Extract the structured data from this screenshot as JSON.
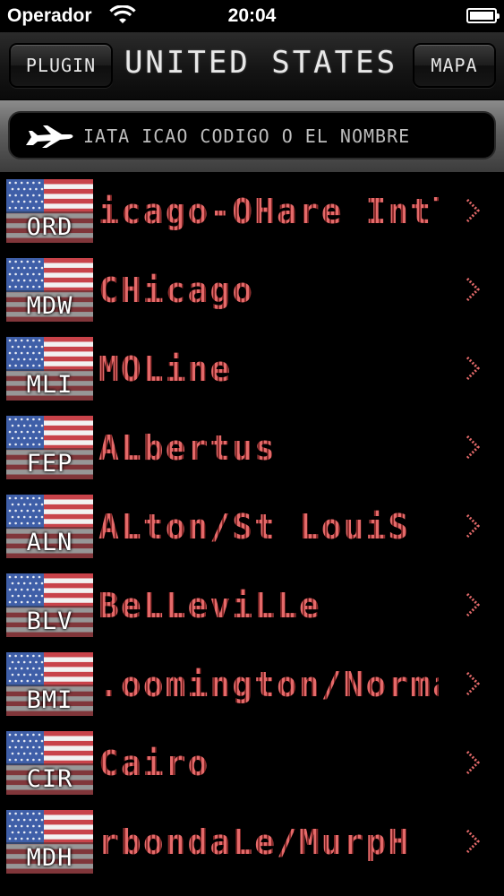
{
  "status_bar": {
    "carrier": "Operador",
    "time": "20:04",
    "battery_level": 1.0
  },
  "nav": {
    "left_button": "PLUGIN",
    "title": "UNITED STATES",
    "right_button": "MAPA"
  },
  "search": {
    "icon": "airplane-icon",
    "placeholder": "IATA ICAO CODIGO O EL NOMBRE"
  },
  "colors": {
    "row_text": "#e46a6a",
    "accent_blue": "#3f5fa8",
    "flag_red": "#c8434a"
  },
  "airports": [
    {
      "code": "ORD",
      "name": "icago-OHare Intl"
    },
    {
      "code": "MDW",
      "name": "CHicago"
    },
    {
      "code": "MLI",
      "name": "MOLine"
    },
    {
      "code": "FEP",
      "name": "ALbertus"
    },
    {
      "code": "ALN",
      "name": "ALton/St LouiS"
    },
    {
      "code": "BLV",
      "name": "BeLLeviLLe"
    },
    {
      "code": "BMI",
      "name": ".oomington/Norma"
    },
    {
      "code": "CIR",
      "name": "Cairo"
    },
    {
      "code": "MDH",
      "name": "rbondaLe/MurpH"
    }
  ]
}
